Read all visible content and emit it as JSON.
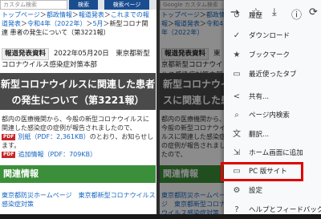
{
  "search": {
    "placeholder_left": "カスタム検索",
    "placeholder_right": "Google カスタム検索",
    "search_label": "検索",
    "search_page_label": "検索ページ"
  },
  "breadcrumb": {
    "top": "トップページ",
    "news": "都政情報",
    "press": "報道発表",
    "past": "これまでの報道発表",
    "year": "令和4年（2022年）",
    "month": "5月",
    "current": "新型コロナ関連 患者の発生について（第3221報）"
  },
  "press": {
    "badge": "報道発表資料",
    "date": "2022年05月20日",
    "dept": "東京都新型コロナウイルス感染症対策本部"
  },
  "article": {
    "title": "新型コロナウイルスに関連した患者の発生について（第3221報）",
    "body": "都内の医療機関から、今般の新型コロナウイルスに関連した感染症の症例が報告されましたので、",
    "attachment_label": "別紙（PDF：2,361KB）",
    "attachment_suffix": "のとおり、お知らせします。",
    "form_label": "追加情報（PDF：709KB）",
    "pdf_tag": "PDF"
  },
  "related": {
    "heading": "関連情報",
    "links": "東京都防災ホームページ　東京都新型コロナウイルス感染症対策"
  },
  "menu": {
    "items": [
      {
        "label": "履歴",
        "icon": "history-icon",
        "glyph": "↺"
      },
      {
        "label": "ダウンロード",
        "icon": "download-icon",
        "glyph": "✓"
      },
      {
        "label": "ブックマーク",
        "icon": "star-icon",
        "glyph": "★"
      },
      {
        "label": "最近使ったタブ",
        "icon": "recent-tabs-icon",
        "glyph": "▭"
      },
      {
        "label": "共有...",
        "icon": "share-icon",
        "glyph": "<"
      },
      {
        "label": "ページ内検索",
        "icon": "find-in-page-icon",
        "glyph": "⌕"
      },
      {
        "label": "翻訳...",
        "icon": "translate-icon",
        "glyph": "文"
      },
      {
        "label": "ホーム画面に追加",
        "icon": "add-to-home-icon",
        "glyph": "⇲"
      },
      {
        "label": "PC 版サイト",
        "icon": "desktop-site-icon",
        "glyph": "▭"
      },
      {
        "label": "設定",
        "icon": "settings-icon",
        "glyph": "⚙"
      },
      {
        "label": "ヘルプとフィードバック",
        "icon": "help-icon",
        "glyph": "?"
      }
    ]
  }
}
